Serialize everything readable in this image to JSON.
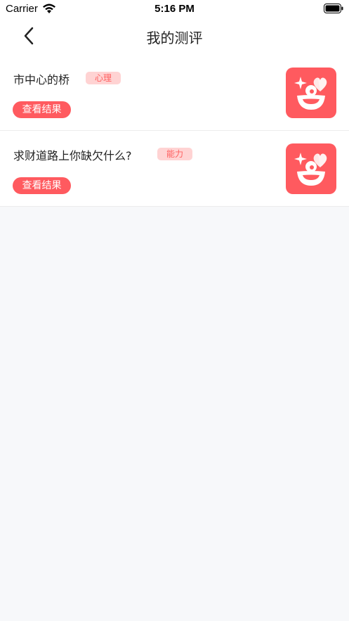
{
  "status_bar": {
    "carrier": "Carrier",
    "time": "5:16 PM"
  },
  "nav": {
    "title": "我的测评",
    "back_icon": "chevron-left-icon"
  },
  "items": [
    {
      "title": "市中心的桥",
      "tag": "心理",
      "button_label": "查看结果",
      "thumb_icon": "smile-heart-icon"
    },
    {
      "title": "求财道路上你缺欠什么?",
      "tag": "能力",
      "button_label": "查看结果",
      "thumb_icon": "smile-heart-icon"
    }
  ],
  "colors": {
    "accent": "#ff5a5f",
    "tag_bg": "#ffd3d3",
    "tag_text": "#ff5f5f",
    "background": "#f7f8fa"
  }
}
